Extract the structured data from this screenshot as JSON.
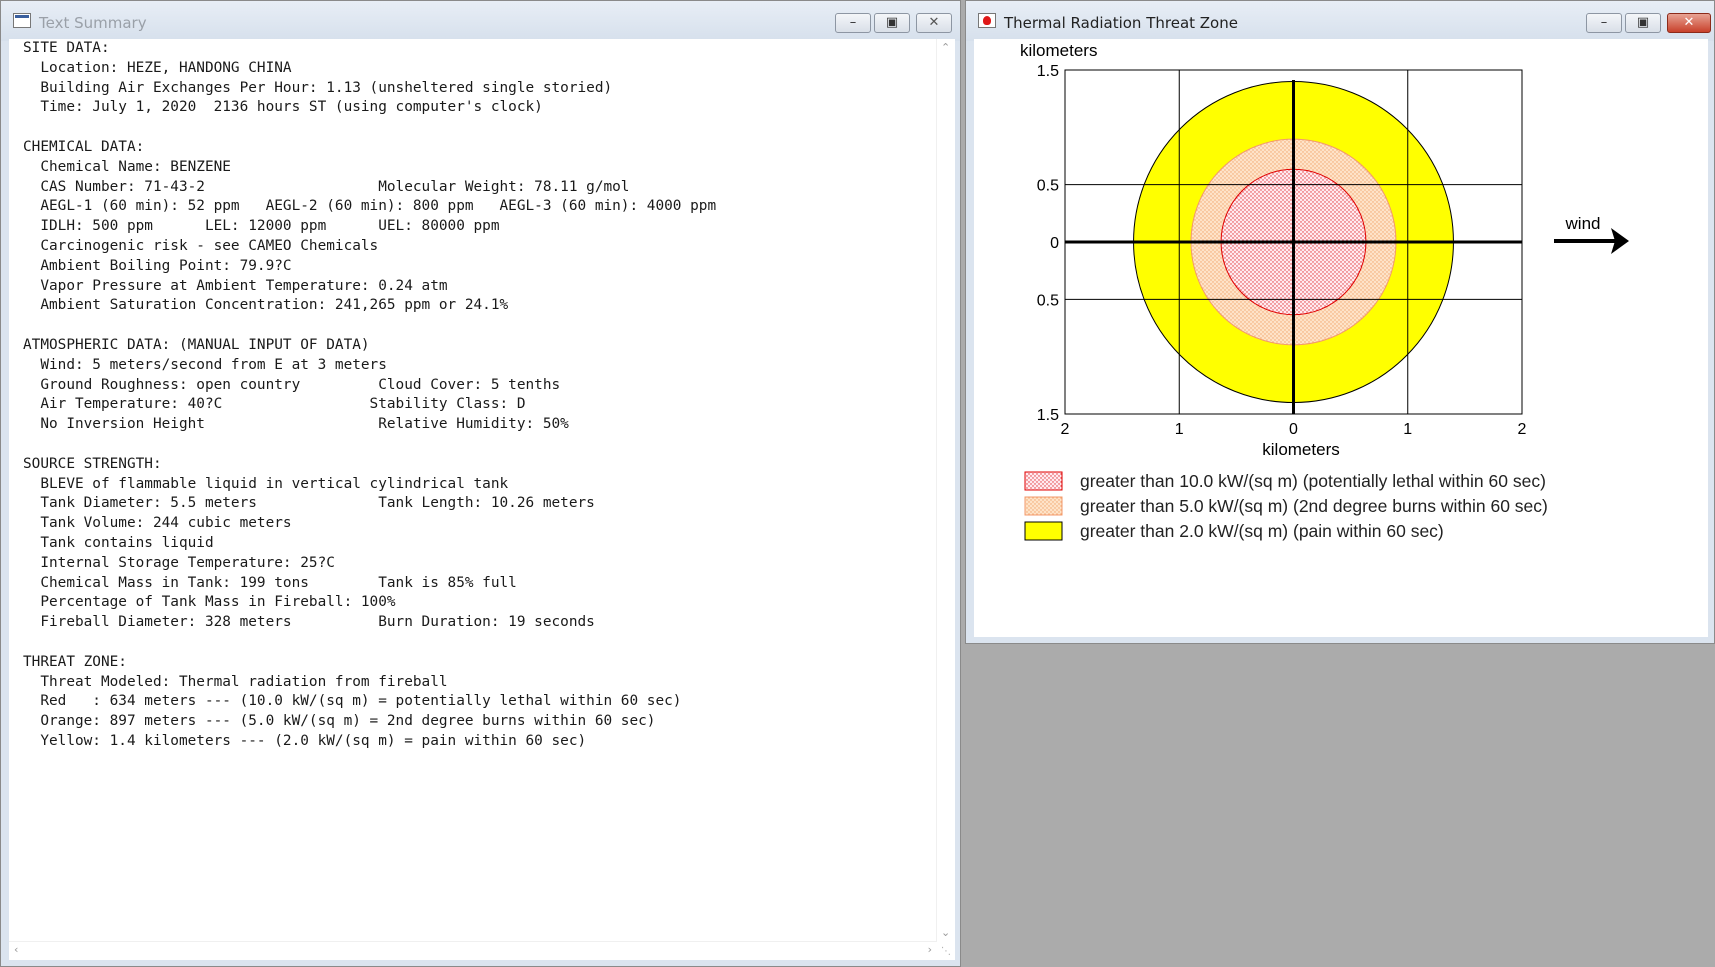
{
  "text_window": {
    "title": "Text Summary",
    "lines": [
      "SITE DATA:",
      "  Location: HEZE, HANDONG CHINA",
      "  Building Air Exchanges Per Hour: 1.13 (unsheltered single storied)",
      "  Time: July 1, 2020  2136 hours ST (using computer's clock)",
      "",
      "CHEMICAL DATA:",
      "  Chemical Name: BENZENE",
      "  CAS Number: 71-43-2                    Molecular Weight: 78.11 g/mol",
      "  AEGL-1 (60 min): 52 ppm   AEGL-2 (60 min): 800 ppm   AEGL-3 (60 min): 4000 ppm",
      "  IDLH: 500 ppm      LEL: 12000 ppm      UEL: 80000 ppm",
      "  Carcinogenic risk - see CAMEO Chemicals",
      "  Ambient Boiling Point: 79.9?C",
      "  Vapor Pressure at Ambient Temperature: 0.24 atm",
      "  Ambient Saturation Concentration: 241,265 ppm or 24.1%",
      "",
      "ATMOSPHERIC DATA: (MANUAL INPUT OF DATA)",
      "  Wind: 5 meters/second from E at 3 meters",
      "  Ground Roughness: open country         Cloud Cover: 5 tenths",
      "  Air Temperature: 40?C                 Stability Class: D",
      "  No Inversion Height                    Relative Humidity: 50%",
      "",
      "SOURCE STRENGTH:",
      "  BLEVE of flammable liquid in vertical cylindrical tank",
      "  Tank Diameter: 5.5 meters              Tank Length: 10.26 meters",
      "  Tank Volume: 244 cubic meters",
      "  Tank contains liquid",
      "  Internal Storage Temperature: 25?C",
      "  Chemical Mass in Tank: 199 tons        Tank is 85% full",
      "  Percentage of Tank Mass in Fireball: 100%",
      "  Fireball Diameter: 328 meters          Burn Duration: 19 seconds",
      "",
      "THREAT ZONE:",
      "  Threat Modeled: Thermal radiation from fireball",
      "  Red   : 634 meters --- (10.0 kW/(sq m) = potentially lethal within 60 sec)",
      "  Orange: 897 meters --- (5.0 kW/(sq m) = 2nd degree burns within 60 sec)",
      "  Yellow: 1.4 kilometers --- (2.0 kW/(sq m) = pain within 60 sec)"
    ]
  },
  "chart_window": {
    "title": "Thermal Radiation Threat Zone"
  },
  "window_buttons": {
    "minimize": "–",
    "maximize": "▣",
    "close": "✕"
  },
  "chart_data": {
    "type": "threat_zone_plot",
    "y_axis_title": "kilometers",
    "x_axis_title": "kilometers",
    "x_range": [
      -2,
      2
    ],
    "y_range": [
      -1.5,
      1.5
    ],
    "x_ticks": [
      {
        "value": -2,
        "label": "2"
      },
      {
        "value": -1,
        "label": "1"
      },
      {
        "value": 0,
        "label": "0"
      },
      {
        "value": 1,
        "label": "1"
      },
      {
        "value": 2,
        "label": "2"
      }
    ],
    "y_ticks": [
      {
        "value": 1.5,
        "label": "1.5"
      },
      {
        "value": 0.5,
        "label": "0.5"
      },
      {
        "value": 0,
        "label": "0"
      },
      {
        "value": -0.5,
        "label": "0.5"
      },
      {
        "value": -1.5,
        "label": "1.5"
      }
    ],
    "grid": true,
    "wind_label": "wind",
    "wind_direction": "east",
    "zones": [
      {
        "label": "greater than 2.0 kW/(sq m) (pain within 60 sec)",
        "radius_km": 1.4,
        "fill": "#ffff00",
        "stroke": "#000000",
        "pattern": "solid"
      },
      {
        "label": "greater than 5.0 kW/(sq m) (2nd degree burns within 60 sec)",
        "radius_km": 0.897,
        "fill": "#fde0c0",
        "stroke": "#f39a6b",
        "pattern": "dots-orange"
      },
      {
        "label": "greater than 10.0 kW/(sq m) (potentially lethal within 60 sec)",
        "radius_km": 0.634,
        "fill": "#ffe8ec",
        "stroke": "#e00000",
        "pattern": "dots-red"
      }
    ],
    "legend_order": [
      2,
      1,
      0
    ]
  }
}
